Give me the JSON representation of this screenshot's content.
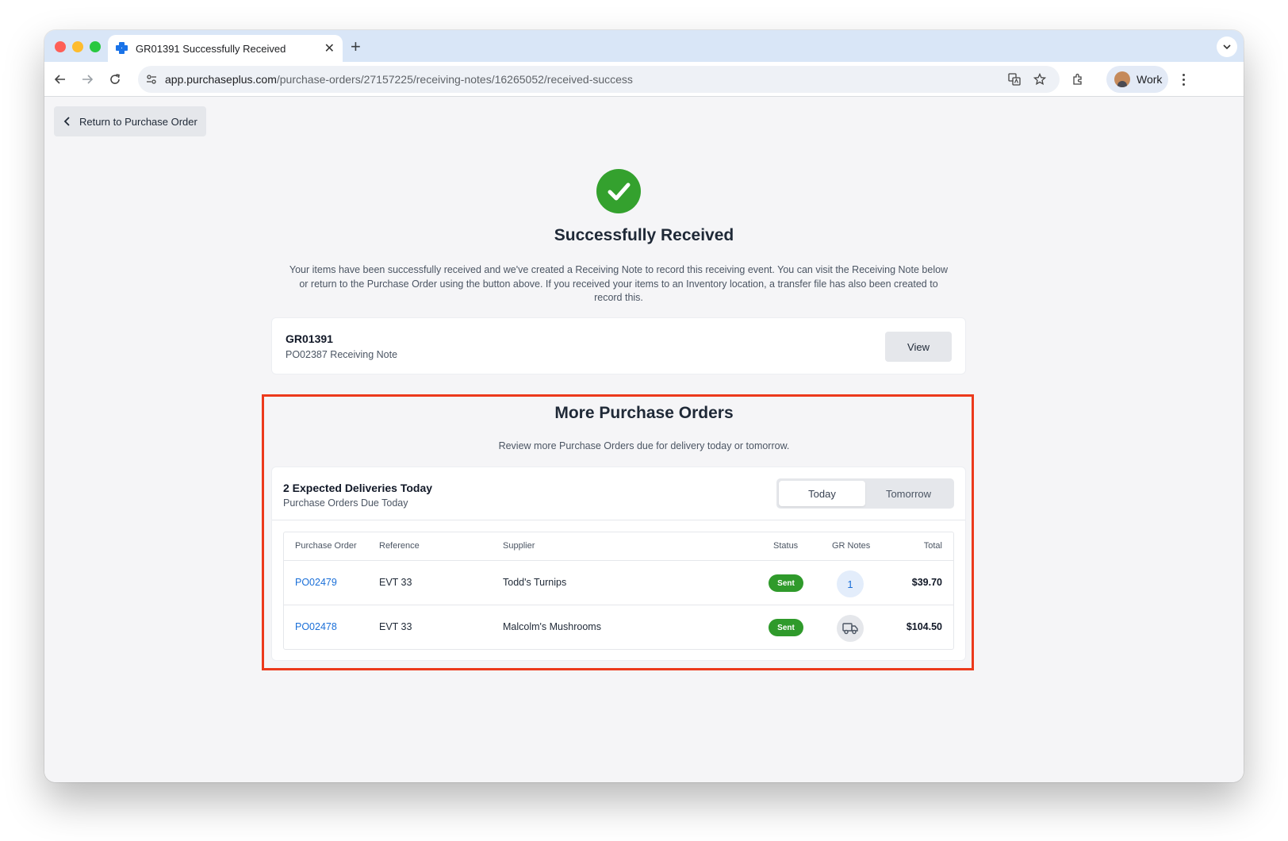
{
  "browser": {
    "tab_title": "GR01391 Successfully Received",
    "url_host": "app.purchaseplus.com",
    "url_path": "/purchase-orders/27157225/receiving-notes/16265052/received-success",
    "profile_name": "Work"
  },
  "page": {
    "return_label": "Return to Purchase Order",
    "success_title": "Successfully Received",
    "success_description": "Your items have been successfully received and we've created a Receiving Note to record this receiving event. You can visit the Receiving Note below or return to the Purchase Order using the button above. If you received your items to an Inventory location, a transfer file has also been created to record this.",
    "receiving_note": {
      "number": "GR01391",
      "subtitle": "PO02387 Receiving Note",
      "view_label": "View"
    },
    "more_orders": {
      "title": "More Purchase Orders",
      "subtitle": "Review more Purchase Orders due for delivery today or tomorrow.",
      "deliveries_title": "2 Expected Deliveries Today",
      "deliveries_subtitle": "Purchase Orders Due Today",
      "toggle": {
        "today": "Today",
        "tomorrow": "Tomorrow",
        "selected": "Today"
      },
      "columns": {
        "purchase_order": "Purchase Order",
        "reference": "Reference",
        "supplier": "Supplier",
        "status": "Status",
        "gr_notes": "GR Notes",
        "total": "Total"
      },
      "rows": [
        {
          "po": "PO02479",
          "reference": "EVT 33",
          "supplier": "Todd's Turnips",
          "status": "Sent",
          "gr_notes": "1",
          "total": "$39.70"
        },
        {
          "po": "PO02478",
          "reference": "EVT 33",
          "supplier": "Malcolm's Mushrooms",
          "status": "Sent",
          "gr_notes_icon": "truck-icon",
          "total": "$104.50"
        }
      ]
    }
  },
  "colors": {
    "success_green": "#34a12e",
    "link_blue": "#1a6fd8",
    "highlight_red": "#ec3a1c"
  }
}
